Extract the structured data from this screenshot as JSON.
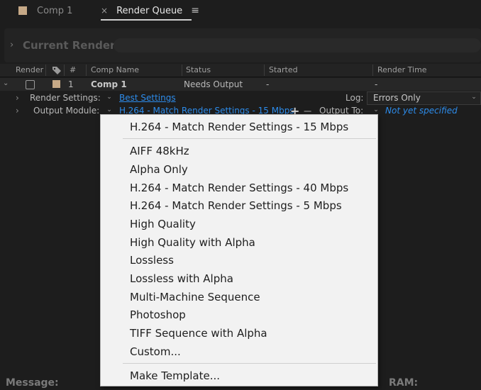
{
  "tabs": [
    {
      "label": "Comp 1",
      "swatch_color": "#c6a987"
    },
    {
      "label": "Render Queue",
      "close": "×",
      "menu": "≡"
    }
  ],
  "current_render": {
    "title": "Current Render"
  },
  "columns": [
    "Render",
    "#",
    "Comp Name",
    "Status",
    "Started",
    "Render Time"
  ],
  "queue_item": {
    "index": "1",
    "comp_name": "Comp 1",
    "status": "Needs Output",
    "started": "-",
    "render_time": "-",
    "label_color": "#c6a987"
  },
  "render_settings": {
    "label": "Render Settings:",
    "value": "Best Settings",
    "log_label": "Log:",
    "log_value": "Errors Only"
  },
  "output_module": {
    "label": "Output Module:",
    "value": "H.264 - Match Render Settings - 15 Mbps",
    "output_to_label": "Output To:",
    "output_to_value": "Not yet specified"
  },
  "menu": {
    "current": "H.264 - Match Render Settings - 15 Mbps",
    "items": [
      "AIFF 48kHz",
      "Alpha Only",
      "H.264 - Match Render Settings - 40 Mbps",
      "H.264 - Match Render Settings - 5 Mbps",
      "High Quality",
      "High Quality with Alpha",
      "Lossless",
      "Lossless with Alpha",
      "Multi-Machine Sequence",
      "Photoshop",
      "TIFF Sequence with Alpha",
      "Custom..."
    ],
    "template": "Make Template..."
  },
  "footer": {
    "message_label": "Message:",
    "ram_label": "RAM:"
  }
}
